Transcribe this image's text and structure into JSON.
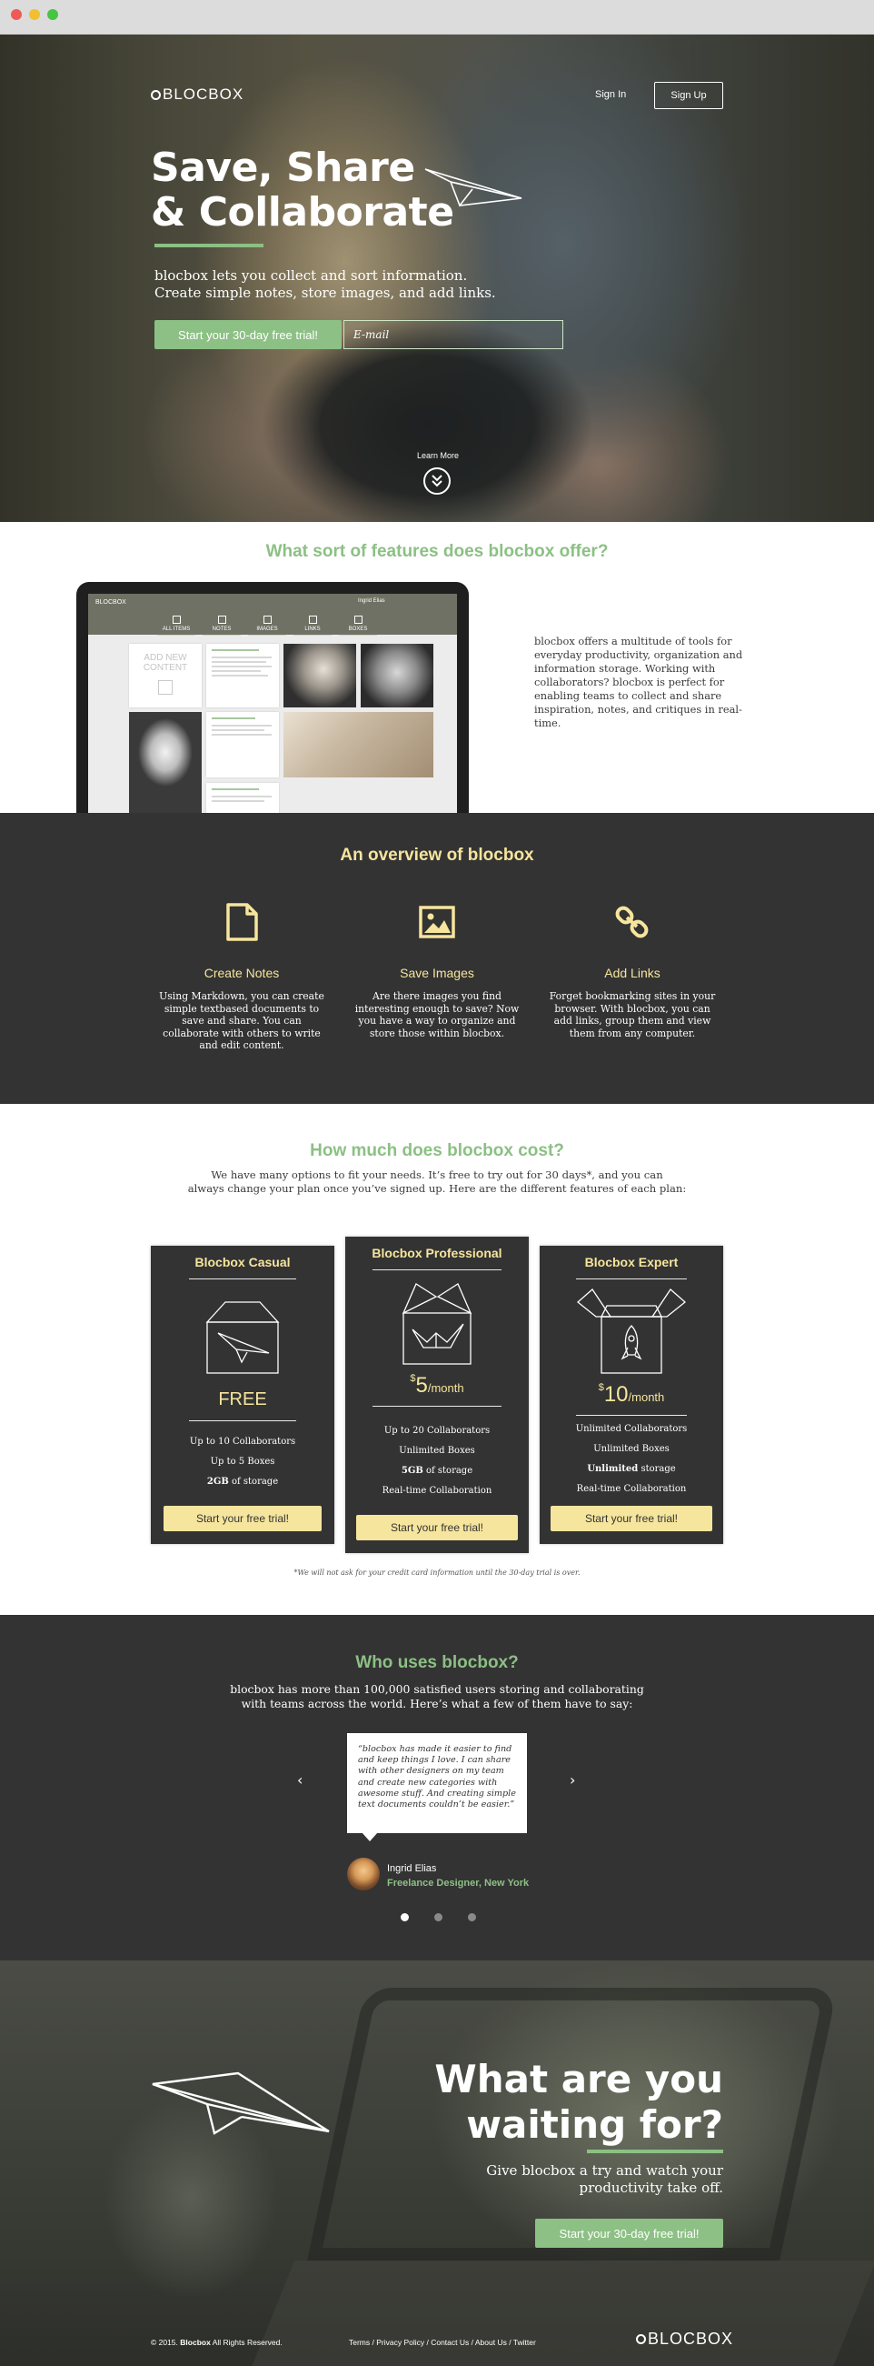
{
  "hero": {
    "logo": "BLOCBOX",
    "signin": "Sign In",
    "signup": "Sign Up",
    "title_line1": "Save, Share",
    "title_line2": "& Collaborate",
    "subtitle_line1": "blocbox lets you collect and sort information.",
    "subtitle_line2": "Create simple notes, store images, and add links.",
    "trial_button": "Start your 30-day free trial!",
    "email_placeholder": "E-mail",
    "learn_more": "Learn More"
  },
  "features": {
    "title": "What sort of features does blocbox offer?",
    "screen": {
      "logo": "BLOCBOX",
      "user": "Ingrid Elias",
      "tabs": [
        "ALL ITEMS",
        "NOTES",
        "IMAGES",
        "LINKS",
        "BOXES"
      ],
      "add_new": [
        "ADD NEW",
        "CONTENT"
      ]
    },
    "text": "blocbox offers a multitude of tools for everyday productivity, organization and information storage. Working with collaborators? blocbox is perfect for enabling teams to collect and share inspiration, notes, and critiques in real-time."
  },
  "overview": {
    "title": "An overview of blocbox",
    "items": [
      {
        "icon": "document-icon",
        "heading": "Create Notes",
        "body": "Using Markdown, you can create simple textbased documents to save and share. You can collaborate with others to write and edit content."
      },
      {
        "icon": "image-icon",
        "heading": "Save Images",
        "body": "Are there images you find interesting enough to save? Now you have a way to organize and store those within blocbox."
      },
      {
        "icon": "link-icon",
        "heading": "Add Links",
        "body": "Forget bookmarking sites in your browser. With blocbox, you can add links, group them and view them from any computer."
      }
    ]
  },
  "pricing": {
    "title": "How much does blocbox cost?",
    "intro_line1": "We have many options to fit your needs. It’s free to try out for 30 days*, and you can",
    "intro_line2": "always change your plan once you’ve signed up. Here are the different features of each plan:",
    "plans": [
      {
        "name": "Blocbox Casual",
        "price": "FREE",
        "currency": "",
        "period": "",
        "features": [
          [
            "",
            "Up to 10 Collaborators",
            ""
          ],
          [
            "",
            "Up to 5 Boxes",
            ""
          ],
          [
            "2GB",
            " of storage",
            ""
          ]
        ],
        "button": "Start your free trial!",
        "art": "paper-plane-box-icon"
      },
      {
        "name": "Blocbox Professional",
        "price": "5",
        "currency": "$",
        "period": "/month",
        "features": [
          [
            "",
            "Up to 20 Collaborators",
            ""
          ],
          [
            "",
            "Unlimited Boxes",
            ""
          ],
          [
            "5GB",
            " of storage",
            ""
          ],
          [
            "",
            "Real-time Collaboration",
            ""
          ]
        ],
        "button": "Start your free trial!",
        "art": "crane-box-icon"
      },
      {
        "name": "Blocbox Expert",
        "price": "10",
        "currency": "$",
        "period": "/month",
        "features": [
          [
            "",
            "Unlimited Collaborators",
            ""
          ],
          [
            "",
            "Unlimited Boxes",
            ""
          ],
          [
            "Unlimited",
            " storage",
            ""
          ],
          [
            "",
            "Real-time Collaboration",
            ""
          ]
        ],
        "button": "Start your free trial!",
        "art": "rocket-box-icon"
      }
    ],
    "footnote": "*We will not ask for your credit card information until the 30-day trial is over."
  },
  "testimonials": {
    "title": "Who uses blocbox?",
    "sub_line1": "blocbox has more than 100,000 satisfied users storing and collaborating",
    "sub_line2": "with teams across the world. Here’s what a few of them have to say:",
    "quote": "“blocbox has made it easier to find and keep things I love. I can share with other designers on my team and create new categories with awesome stuff. And creating simple text documents couldn’t be easier.”",
    "author": "Ingrid Elias",
    "role": "Freelance Designer, New York",
    "prev": "‹",
    "next": "›",
    "active_page": 0,
    "pages": 3
  },
  "cta": {
    "title_line1": "What are you",
    "title_line2": "waiting for?",
    "sub_line1": "Give blocbox a try and watch your",
    "sub_line2": "productivity take off.",
    "button": "Start your 30-day free trial!"
  },
  "footer": {
    "copy_year": "© 2015.",
    "copy_brand": "Blocbox",
    "copy_rest": "All Rights Reserved.",
    "links": "Terms / Privacy Policy / Contact Us / About Us / Twitter",
    "logo": "BLOCBOX"
  },
  "colors": {
    "accent_green": "#8cc084",
    "accent_yellow": "#f6e59d",
    "dark": "#333333"
  }
}
